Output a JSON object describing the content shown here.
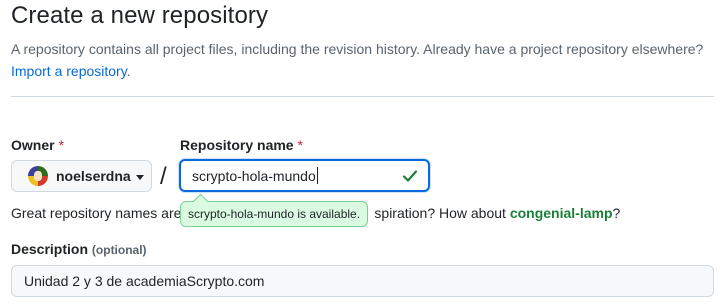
{
  "header": {
    "title": "Create a new repository",
    "subtitle": "A repository contains all project files, including the revision history. Already have a project repository elsewhere?",
    "import_link": "Import a repository",
    "import_suffix": "."
  },
  "owner": {
    "label": "Owner",
    "required_mark": "*",
    "selected": "noelserdna"
  },
  "repo_name": {
    "label": "Repository name",
    "required_mark": "*",
    "value": "scrypto-hola-mundo",
    "availability_tooltip": "scrypto-hola-mundo is available."
  },
  "separator": "/",
  "hint": {
    "prefix": "Great repository names are",
    "middle": "spiration? How about",
    "suggestion": "congenial-lamp",
    "suffix": "?"
  },
  "description": {
    "label": "Description",
    "optional": "(optional)",
    "value": "Unidad 2 y 3 de academiaScrypto.com"
  },
  "colors": {
    "accent": "#0969da",
    "success": "#1a7f37",
    "danger": "#d1242f"
  },
  "icons": [
    "avatar",
    "chevron-down-icon",
    "check-icon"
  ]
}
